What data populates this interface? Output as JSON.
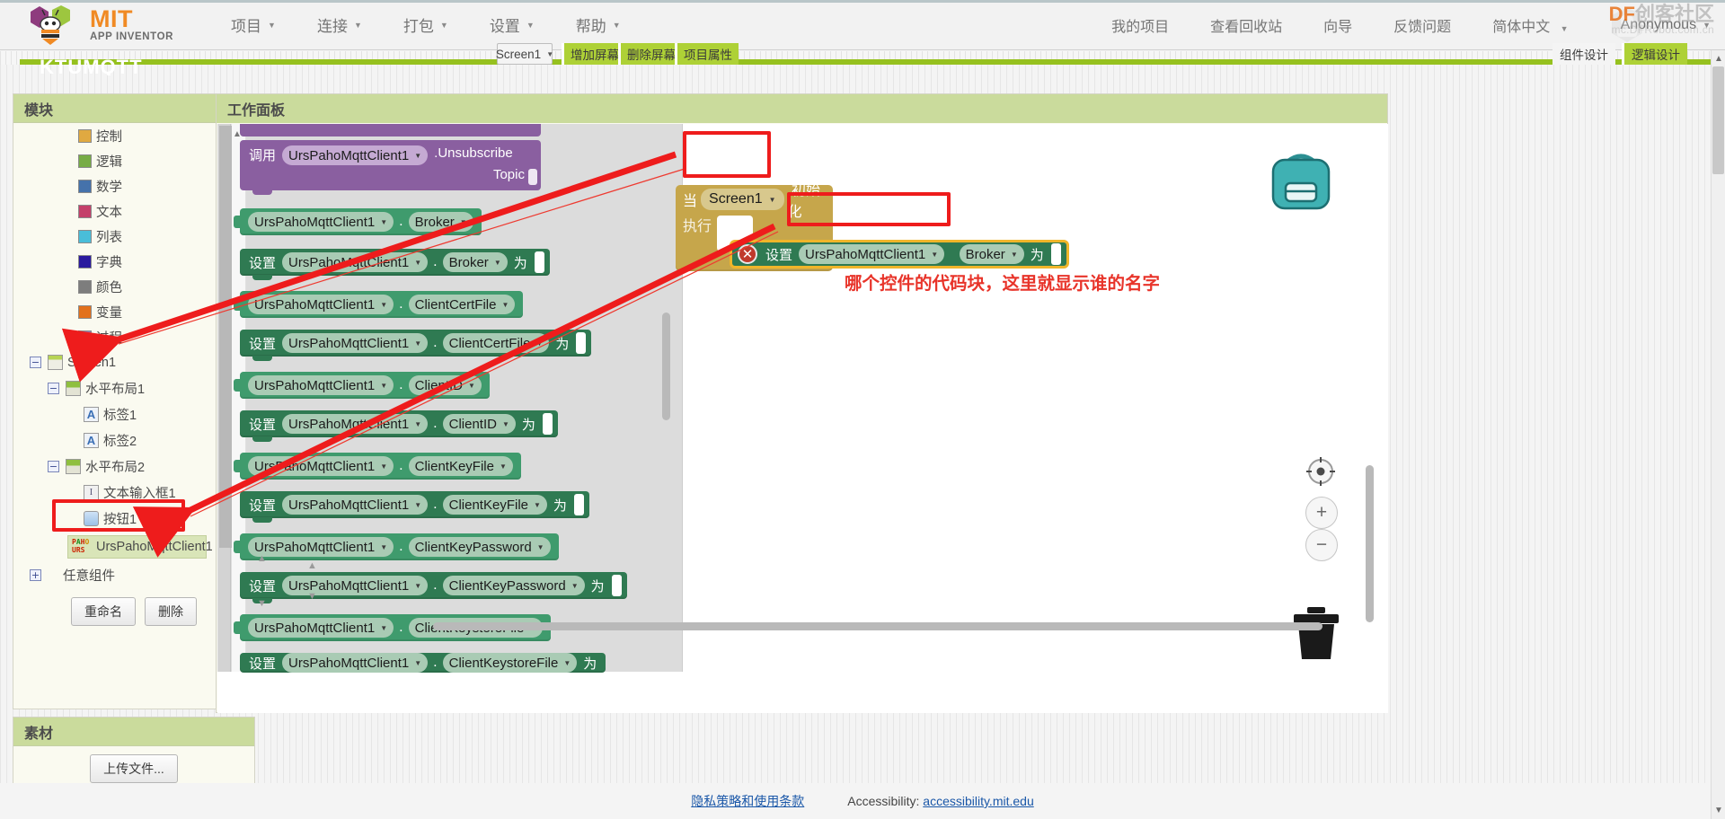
{
  "header": {
    "logo_mit": "MIT",
    "logo_sub": "APP INVENTOR",
    "menus": [
      {
        "label": "项目",
        "name": "menu-project"
      },
      {
        "label": "连接",
        "name": "menu-connect"
      },
      {
        "label": "打包",
        "name": "menu-build"
      },
      {
        "label": "设置",
        "name": "menu-settings"
      },
      {
        "label": "帮助",
        "name": "menu-help"
      }
    ],
    "right_links": [
      {
        "label": "我的项目"
      },
      {
        "label": "查看回收站"
      },
      {
        "label": "向导"
      },
      {
        "label": "反馈问题"
      },
      {
        "label": "简体中文"
      }
    ],
    "user": "Anonymous",
    "watermark_brand": "DF",
    "watermark_brand_cn": "创客社区",
    "watermark_url": "mc.DFRobot.com.cn"
  },
  "project_bar": {
    "title": "KTUMQTT",
    "screen_selected": "Screen1",
    "add_screen": "增加屏幕",
    "remove_screen": "删除屏幕",
    "project_properties": "项目属性",
    "tab_designer": "组件设计",
    "tab_blocks": "逻辑设计"
  },
  "palette": {
    "title": "模块",
    "categories": [
      {
        "label": "控制",
        "color": "#e0a941"
      },
      {
        "label": "逻辑",
        "color": "#77ac45"
      },
      {
        "label": "数学",
        "color": "#4572ab"
      },
      {
        "label": "文本",
        "color": "#c4406a"
      },
      {
        "label": "列表",
        "color": "#49bdd9"
      },
      {
        "label": "字典",
        "color": "#2a1a9e"
      },
      {
        "label": "颜色",
        "color": "#7d7d7d"
      },
      {
        "label": "变量",
        "color": "#e2711d"
      },
      {
        "label": "过程",
        "color": "#9a79b6"
      }
    ],
    "tree": [
      {
        "label": "Screen1",
        "depth": 0,
        "expander": "−",
        "icon": "screen-icon"
      },
      {
        "label": "水平布局1",
        "depth": 1,
        "expander": "−",
        "icon": "harrangement-icon"
      },
      {
        "label": "标签1",
        "depth": 2,
        "expander": "",
        "icon": "label-icon"
      },
      {
        "label": "标签2",
        "depth": 2,
        "expander": "",
        "icon": "label-icon"
      },
      {
        "label": "水平布局2",
        "depth": 1,
        "expander": "−",
        "icon": "harrangement-icon"
      },
      {
        "label": "文本输入框1",
        "depth": 2,
        "expander": "",
        "icon": "textbox-icon"
      },
      {
        "label": "按钮1",
        "depth": 2,
        "expander": "",
        "icon": "button-icon"
      }
    ],
    "selected_component": "UrsPahoMqttClient1",
    "selected_component_icon_top": "PAHO",
    "selected_component_icon_bottom": "URS",
    "any_component": "任意组件",
    "btn_rename": "重命名",
    "btn_delete": "删除"
  },
  "assets": {
    "title": "素材",
    "upload_button": "上传文件..."
  },
  "workspace": {
    "title": "工作面板",
    "flyout_blocks": [
      {
        "kind": "call",
        "zh": "调用",
        "component": "UrsPahoMqttClient1",
        "member": ".Unsubscribe",
        "arg": "Topic"
      },
      {
        "kind": "getter",
        "component": "UrsPahoMqttClient1",
        "member": "Broker"
      },
      {
        "kind": "setter",
        "zh": "设置",
        "component": "UrsPahoMqttClient1",
        "member": "Broker",
        "to": "为"
      },
      {
        "kind": "getter",
        "component": "UrsPahoMqttClient1",
        "member": "ClientCertFile"
      },
      {
        "kind": "setter",
        "zh": "设置",
        "component": "UrsPahoMqttClient1",
        "member": "ClientCertFile",
        "to": "为"
      },
      {
        "kind": "getter",
        "component": "UrsPahoMqttClient1",
        "member": "ClientID"
      },
      {
        "kind": "setter",
        "zh": "设置",
        "component": "UrsPahoMqttClient1",
        "member": "ClientID",
        "to": "为"
      },
      {
        "kind": "getter",
        "component": "UrsPahoMqttClient1",
        "member": "ClientKeyFile"
      },
      {
        "kind": "setter",
        "zh": "设置",
        "component": "UrsPahoMqttClient1",
        "member": "ClientKeyFile",
        "to": "为"
      },
      {
        "kind": "getter",
        "component": "UrsPahoMqttClient1",
        "member": "ClientKeyPassword"
      },
      {
        "kind": "setter",
        "zh": "设置",
        "component": "UrsPahoMqttClient1",
        "member": "ClientKeyPassword",
        "to": "为"
      },
      {
        "kind": "getter",
        "component": "UrsPahoMqttClient1",
        "member": "ClientKeystoreFile"
      },
      {
        "kind": "setter",
        "zh": "设置",
        "component": "UrsPahoMqttClient1",
        "member": "ClientKeystoreFile",
        "to": "为"
      }
    ],
    "event_block": {
      "when": "当",
      "component": "Screen1",
      "event": ".初始化",
      "do": "执行"
    },
    "set_block": {
      "error_mark": "✕",
      "zh": "设置",
      "component": "UrsPahoMqttClient1",
      "member": "Broker",
      "to": "为"
    }
  },
  "annotation": {
    "note": "哪个控件的代码块，这里就显示谁的名字"
  },
  "footer": {
    "privacy": "隐私策略和使用条款",
    "accessibility_label": "Accessibility:",
    "accessibility_link": "accessibility.mit.edu"
  },
  "colors": {
    "brand_green": "#96c11f",
    "panel_head": "#cadb9c",
    "annotation_red": "#ee1c1c",
    "orange": "#f08a24"
  }
}
